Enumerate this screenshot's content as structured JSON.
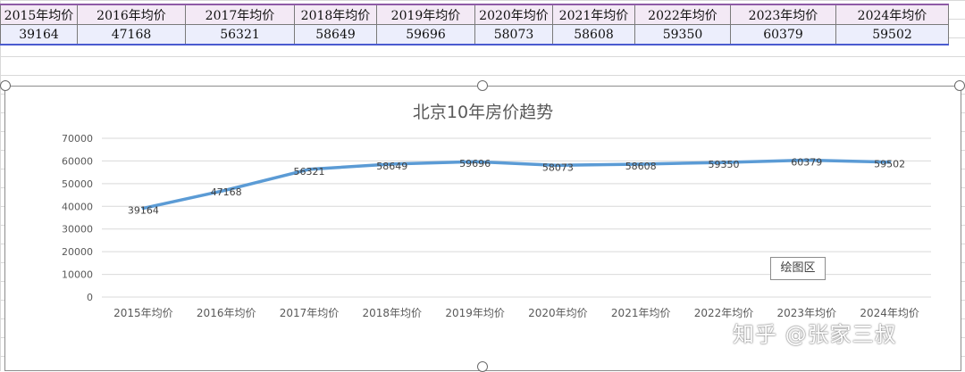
{
  "sheet": {
    "header": [
      "2015年均价",
      "2016年均价",
      "2017年均价",
      "2018年均价",
      "2019年均价",
      "2020年均价",
      "2021年均价",
      "2022年均价",
      "2023年均价",
      "2024年均价"
    ],
    "values": [
      "39164",
      "47168",
      "56321",
      "58649",
      "59696",
      "58073",
      "58608",
      "59350",
      "60379",
      "59502"
    ]
  },
  "chart_data": {
    "type": "line",
    "title": "北京10年房价趋势",
    "categories": [
      "2015年均价",
      "2016年均价",
      "2017年均价",
      "2018年均价",
      "2019年均价",
      "2020年均价",
      "2021年均价",
      "2022年均价",
      "2023年均价",
      "2024年均价"
    ],
    "series": [
      {
        "values": [
          39164,
          47168,
          56321,
          58649,
          59696,
          58073,
          58608,
          59350,
          60379,
          59502
        ]
      }
    ],
    "ylim": [
      0,
      70000
    ],
    "yticks": [
      0,
      10000,
      20000,
      30000,
      40000,
      50000,
      60000,
      70000
    ],
    "grid": true,
    "legend": "none",
    "data_labels": true,
    "line_color": "#5b9bd5"
  },
  "plot_area_label": "绘图区",
  "watermark": "知乎 @张家三叔"
}
